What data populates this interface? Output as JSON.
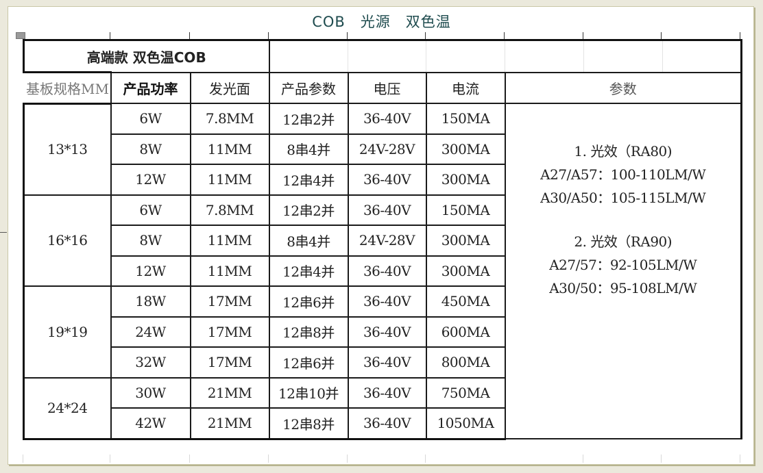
{
  "document_title": "COB　光源　双色温",
  "table": {
    "banner": "高端款  双色温COB",
    "headers": [
      "基板规格MM",
      "产品功率",
      "发光面",
      "产品参数",
      "电压",
      "电流",
      "参数"
    ],
    "groups": [
      {
        "substrate": "13*13",
        "rows": [
          {
            "power": "6W",
            "emitting_surface": "7.8MM",
            "config": "12串2并",
            "voltage": "36-40V",
            "current": "150MA"
          },
          {
            "power": "8W",
            "emitting_surface": "11MM",
            "config": "8串4并",
            "voltage": "24V-28V",
            "current": "300MA"
          },
          {
            "power": "12W",
            "emitting_surface": "11MM",
            "config": "12串4并",
            "voltage": "36-40V",
            "current": "300MA"
          }
        ]
      },
      {
        "substrate": "16*16",
        "rows": [
          {
            "power": "6W",
            "emitting_surface": "7.8MM",
            "config": "12串2并",
            "voltage": "36-40V",
            "current": "150MA"
          },
          {
            "power": "8W",
            "emitting_surface": "11MM",
            "config": "8串4并",
            "voltage": "24V-28V",
            "current": "300MA"
          },
          {
            "power": "12W",
            "emitting_surface": "11MM",
            "config": "12串4并",
            "voltage": "36-40V",
            "current": "300MA"
          }
        ]
      },
      {
        "substrate": "19*19",
        "rows": [
          {
            "power": "18W",
            "emitting_surface": "17MM",
            "config": "12串6并",
            "voltage": "36-40V",
            "current": "450MA"
          },
          {
            "power": "24W",
            "emitting_surface": "17MM",
            "config": "12串8并",
            "voltage": "36-40V",
            "current": "600MA"
          },
          {
            "power": "32W",
            "emitting_surface": "17MM",
            "config": "12串6并",
            "voltage": "36-40V",
            "current": "800MA"
          }
        ]
      },
      {
        "substrate": "24*24",
        "rows": [
          {
            "power": "30W",
            "emitting_surface": "21MM",
            "config": "12串10并",
            "voltage": "36-40V",
            "current": "750MA"
          },
          {
            "power": "42W",
            "emitting_surface": "21MM",
            "config": "12串8并",
            "voltage": "36-40V",
            "current": "1050MA"
          }
        ]
      }
    ],
    "params": {
      "ra80": {
        "heading": "1. 光效（RA80)",
        "lines": [
          "A27/A57：100-110LM/W",
          "A30/A50：105-115LM/W"
        ]
      },
      "ra90": {
        "heading": "2. 光效（RA90)",
        "lines": [
          "A27/57：92-105LM/W",
          "A30/50：95-108LM/W"
        ]
      }
    }
  }
}
